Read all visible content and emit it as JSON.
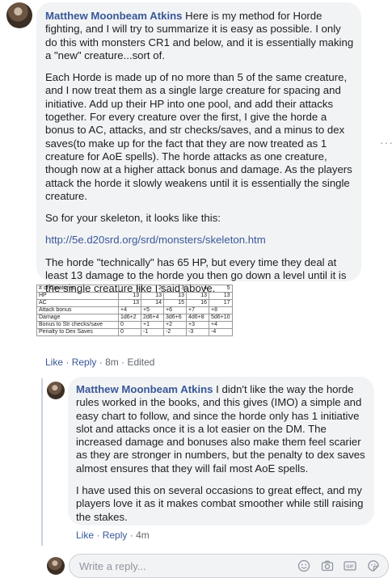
{
  "comment": {
    "author": "Matthew Moonbeam Atkins",
    "p1": "Here is my method for Horde fighting, and I will try to summarize it is easy as possible. I only do this with monsters CR1 and below, and it is essentially making a \"new\" creature...sort of.",
    "p2": "Each Horde is made up of no more than 5 of the same creature, and I now treat them as a single large creature for spacing and initiative. Add up their HP into one pool, and add their attacks together. For every creature over the first, I give the horde a bonus to AC, attacks, and str checks/saves, and a minus to dex saves(to make up for the fact that they are now treated as 1 creature for AoE spells). The horde attacks as one creature, though now at a higher attack bonus and damage. As the players attack the horde it slowly weakens until it is essentially the single creature.",
    "p3": "So for your skeleton, it looks like this:",
    "link": "http://5e.d20srd.org/srd/monsters/skeleton.htm",
    "p4": "The horde \"technically\" has 65 HP, but every time they deal at least 13 damage to the horde you then go down a level until it is the single creature like I said above.",
    "actions": {
      "like": "Like",
      "reply": "Reply",
      "time": "8m",
      "edited": "Edited"
    }
  },
  "table": {
    "rows": [
      {
        "label": "# of Creatures",
        "values": [
          "1",
          "2",
          "3",
          "4",
          "5"
        ]
      },
      {
        "label": "HP",
        "values": [
          "13",
          "13",
          "13",
          "13",
          "13"
        ]
      },
      {
        "label": "AC",
        "values": [
          "13",
          "14",
          "15",
          "16",
          "17"
        ]
      },
      {
        "label": "Attack bonus",
        "values": [
          "+4",
          "+5",
          "+6",
          "+7",
          "+8"
        ]
      },
      {
        "label": "Damage",
        "values": [
          "1d6+2",
          "2d6+4",
          "3d6+6",
          "4d6+8",
          "5d6+10"
        ]
      },
      {
        "label": "Bonus to Str checks/save",
        "values": [
          "0",
          "+1",
          "+2",
          "+3",
          "+4"
        ]
      },
      {
        "label": "Penalty to Dex Saves",
        "values": [
          "0",
          "-1",
          "-2",
          "-3",
          "-4"
        ]
      }
    ]
  },
  "reply": {
    "author": "Matthew Moonbeam Atkins",
    "p1": "I didn't like the way the horde rules worked in the books, and this gives (IMO) a simple and easy chart to follow, and since the horde only has 1 initiative slot and attacks once it is a lot easier on the DM. The increased damage and bonuses also make them feel scarier as they are stronger in numbers, but the penalty to dex saves almost ensures that they will fail most AoE spells.",
    "p2": "I have used this on several occasions to great effect, and my players love it as it makes combat smoother while still raising the stakes.",
    "actions": {
      "like": "Like",
      "reply": "Reply",
      "time": "4m"
    }
  },
  "composer": {
    "placeholder": "Write a reply...",
    "icons": [
      "emoji-icon",
      "camera-icon",
      "gif-icon",
      "sticker-icon"
    ]
  }
}
